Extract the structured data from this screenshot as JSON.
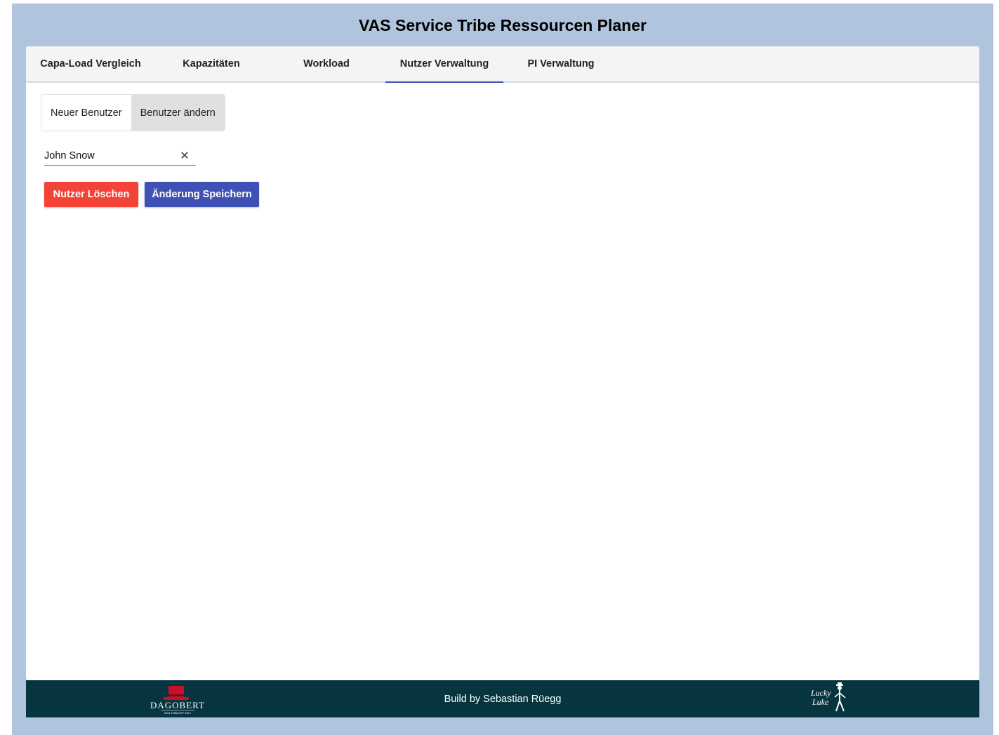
{
  "app": {
    "title": "VAS Service Tribe Ressourcen Planer"
  },
  "colors": {
    "frame": "#b0c4de",
    "accent": "#3f51b5",
    "danger": "#f44336",
    "footer": "#063540"
  },
  "tabs": [
    {
      "label": "Capa-Load Vergleich",
      "active": false
    },
    {
      "label": "Kapazitäten",
      "active": false
    },
    {
      "label": "Workload",
      "active": false
    },
    {
      "label": "Nutzer Verwaltung",
      "active": true
    },
    {
      "label": "PI Verwaltung",
      "active": false
    }
  ],
  "toggle": {
    "new_user": "Neuer Benutzer",
    "edit_user": "Benutzer ändern",
    "selected": "Benutzer ändern"
  },
  "user_select": {
    "value": "John Snow",
    "clear_icon": "close-icon"
  },
  "actions": {
    "delete_label": "Nutzer Löschen",
    "save_label": "Änderung Speichern"
  },
  "footer": {
    "text": "Build by Sebastian Rüegg",
    "left_logo": {
      "name": "dagobert-logo",
      "text": "Dagobert",
      "sub": "GD4 100M EST 2017"
    },
    "right_logo": {
      "name": "lucky-luke-logo",
      "text": "Lucky Luke"
    }
  }
}
